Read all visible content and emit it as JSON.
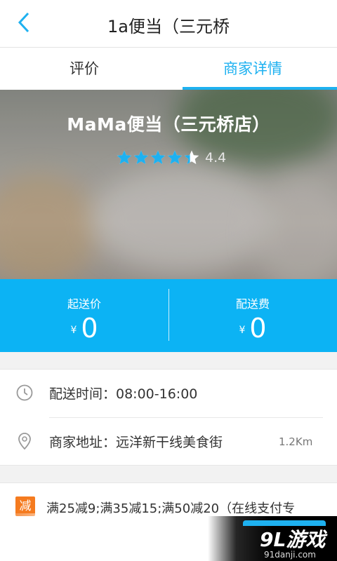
{
  "nav": {
    "title": "1a便当（三元桥"
  },
  "tabs": [
    {
      "label": "评价",
      "active": false
    },
    {
      "label": "商家详情",
      "active": true
    }
  ],
  "store": {
    "name": "MaMa便当（三元桥店）",
    "rating_value": 4.4,
    "rating_text": "4.4",
    "stars_total": 5
  },
  "fees": {
    "min_order_label": "起送价",
    "min_order_currency": "¥",
    "min_order_value": "0",
    "delivery_fee_label": "配送费",
    "delivery_fee_currency": "¥",
    "delivery_fee_value": "0"
  },
  "info": {
    "hours_text": "配送时间：08:00-16:00",
    "address_text": "商家地址：远洋新干线美食街",
    "distance": "1.2Km"
  },
  "promo": {
    "badge": "减",
    "text": "满25减9;满35减15;满50减20（在线支付专"
  },
  "watermark": {
    "logo": "9L游戏",
    "url": "91danji.com"
  },
  "colors": {
    "accent": "#1eb1f0",
    "fee_bar": "#0cb3f4",
    "promo_badge": "#f57b1f"
  },
  "icons": {
    "back": "chevron-left-icon",
    "hours": "clock-icon",
    "address": "location-pin-icon",
    "expand": "chevron-down-icon",
    "rating": "star-icon"
  }
}
